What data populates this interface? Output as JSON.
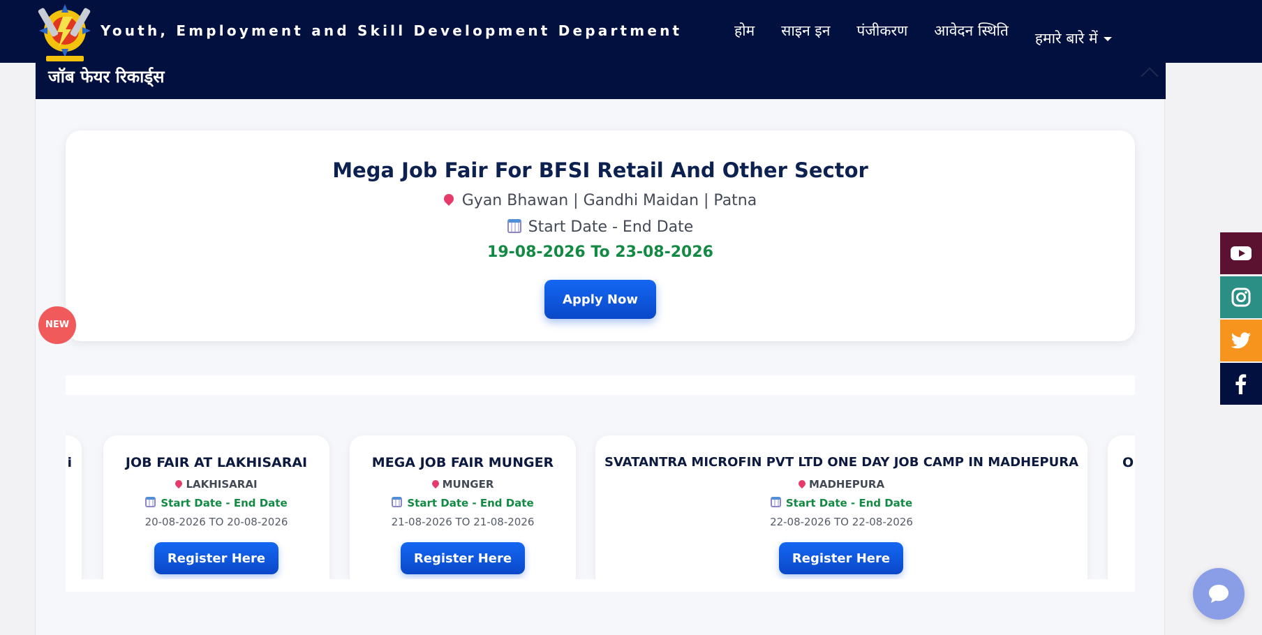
{
  "header": {
    "brand": "Youth, Employment and Skill Development Department",
    "nav": [
      {
        "label": "होम"
      },
      {
        "label": "साइन इन"
      },
      {
        "label": "पंजीकरण"
      },
      {
        "label": "आवेदन स्थिति"
      },
      {
        "label": "हमारे बारे में"
      }
    ]
  },
  "section": {
    "title": "जॉब फेयर रिकार्ड्स"
  },
  "featured": {
    "title": "Mega Job Fair For BFSI Retail And Other Sector",
    "venue": "Gyan Bhawan | Gandhi Maidan | Patna",
    "date_label": "Start Date - End Date",
    "dates": "19-08-2026 To 23-08-2026",
    "apply_label": "Apply Now"
  },
  "badge": {
    "label": "NEW"
  },
  "jobs": [
    {
      "title": "JOB FAIR AT LAKHISARAI",
      "location": "LAKHISARAI",
      "date_label": "Start Date - End Date",
      "dates": "20-08-2026 TO 20-08-2026",
      "button": "Register Here"
    },
    {
      "title": "MEGA JOB FAIR MUNGER",
      "location": "MUNGER",
      "date_label": "Start Date - End Date",
      "dates": "21-08-2026 TO 21-08-2026",
      "button": "Register Here"
    },
    {
      "title": "SVATANTRA MICROFIN PVT LTD ONE DAY JOB CAMP IN MADHEPURA",
      "location": "MADHEPURA",
      "date_label": "Start Date - End Date",
      "dates": "22-08-2026 TO 22-08-2026",
      "button": "Register Here"
    }
  ],
  "partial_cards": {
    "left_fragment": "i",
    "right_fragment": "O"
  },
  "social": [
    {
      "icon": "youtube-icon",
      "color": "#5a1230"
    },
    {
      "icon": "instagram-icon",
      "color": "#2b8f86"
    },
    {
      "icon": "twitter-icon",
      "color": "#f7941d"
    },
    {
      "icon": "facebook-icon",
      "color": "#02103f"
    }
  ],
  "colors": {
    "navy": "#02103f",
    "primary_button": "#0d56dc",
    "date_green": "#138a43",
    "new_badge": "#f05a5a",
    "chat": "#8a9ee8"
  }
}
